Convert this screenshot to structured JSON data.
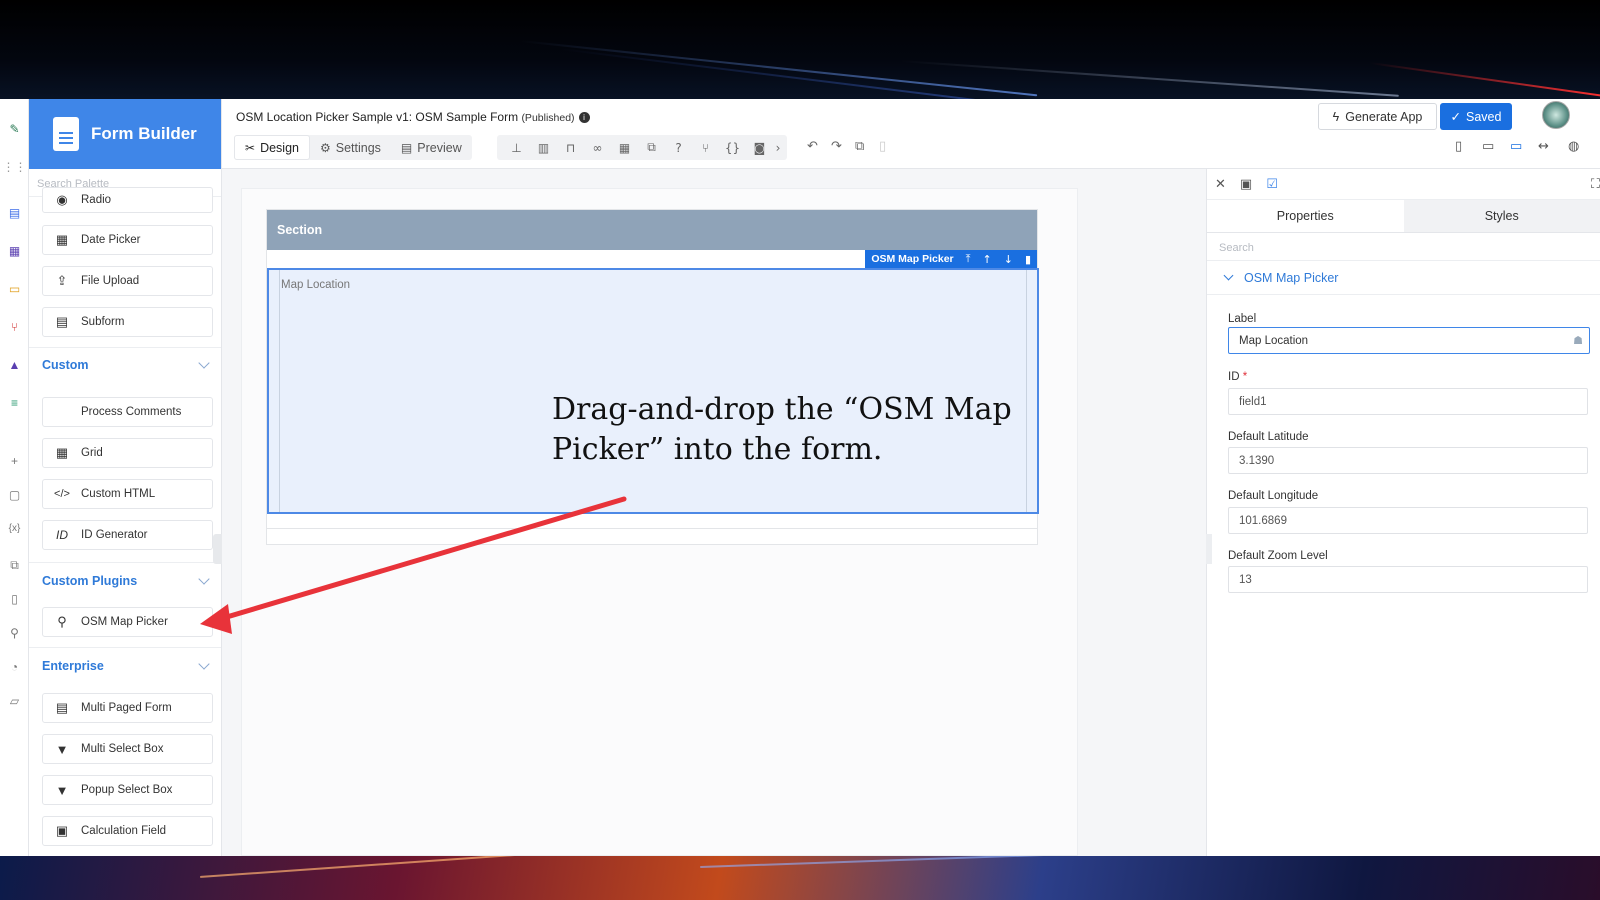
{
  "app": {
    "brand": "Form Builder",
    "form_title": "OSM Location Picker Sample v1: OSM Sample Form",
    "form_status": "(Published)",
    "tabs": [
      {
        "label": "Design",
        "icon": "tools-icon"
      },
      {
        "label": "Settings",
        "icon": "gear-icon"
      },
      {
        "label": "Preview",
        "icon": "preview-icon"
      }
    ],
    "generate_label": "Generate App",
    "saved_label": "Saved"
  },
  "palette": {
    "search_placeholder": "Search Palette",
    "basic_items": [
      {
        "label": "Radio",
        "icon": "radio-icon"
      },
      {
        "label": "Date Picker",
        "icon": "calendar-icon"
      },
      {
        "label": "File Upload",
        "icon": "upload-icon"
      },
      {
        "label": "Subform",
        "icon": "subform-icon"
      }
    ],
    "custom_title": "Custom",
    "custom_items": [
      {
        "label": "Process Comments",
        "icon": ""
      },
      {
        "label": "Grid",
        "icon": "grid-icon"
      },
      {
        "label": "Custom HTML",
        "icon": "code-icon"
      },
      {
        "label": "ID Generator",
        "icon": "id-icon"
      }
    ],
    "plugins_title": "Custom Plugins",
    "plugin_items": [
      {
        "label": "OSM Map Picker",
        "icon": "map-pin-icon"
      }
    ],
    "enterprise_title": "Enterprise",
    "enterprise_items": [
      {
        "label": "Multi Paged Form",
        "icon": "pages-icon"
      },
      {
        "label": "Multi Select Box",
        "icon": "select-icon"
      },
      {
        "label": "Popup Select Box",
        "icon": "popup-select-icon"
      },
      {
        "label": "Calculation Field",
        "icon": "calculator-icon"
      }
    ]
  },
  "canvas": {
    "section_title": "Section",
    "field_toolbar_label": "OSM Map Picker",
    "field_label": "Map Location",
    "annotation": "Drag-and-drop the “OSM Map Picker” into the form."
  },
  "properties": {
    "tab_properties": "Properties",
    "tab_styles": "Styles",
    "search_placeholder": "Search",
    "group_title": "OSM Map Picker",
    "label_label": "Label",
    "label_value": "Map Location",
    "id_label": "ID",
    "id_required": "*",
    "id_value": "field1",
    "lat_label": "Default Latitude",
    "lat_value": "3.1390",
    "lng_label": "Default Longitude",
    "lng_value": "101.6869",
    "zoom_label": "Default Zoom Level",
    "zoom_value": "13"
  },
  "colors": {
    "brand": "#3f86e8",
    "primary_button": "#1a6fe0",
    "section_header": "#8fa3b8",
    "annotation_arrow": "#e8333a"
  }
}
